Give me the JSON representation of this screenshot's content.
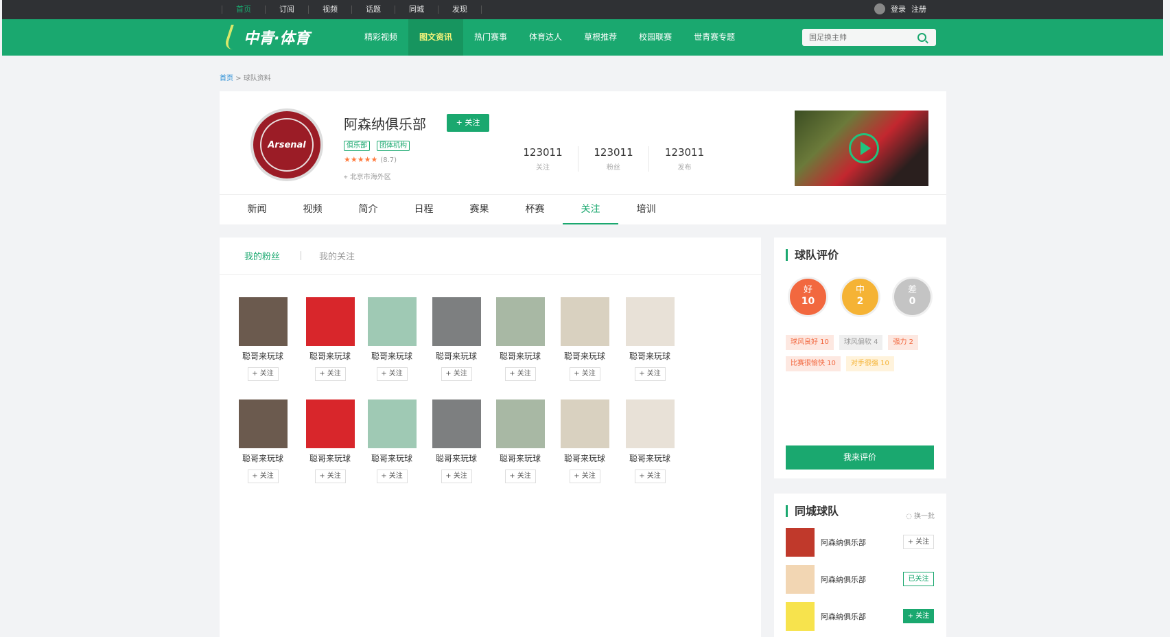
{
  "topbar": {
    "nav": [
      "首页",
      "订阅",
      "视频",
      "话题",
      "同城",
      "发现"
    ],
    "login": "登录",
    "register": "注册"
  },
  "header": {
    "logo_text": "中青·体育",
    "menu": [
      "精彩视频",
      "图文资讯",
      "热门赛事",
      "体育达人",
      "草根推荐",
      "校园联赛",
      "世青赛专题"
    ],
    "search_placeholder": "国足换主帅"
  },
  "breadcrumb": {
    "home": "首页",
    "sep": ">",
    "current": "球队资料"
  },
  "profile": {
    "badge_text": "Arsenal",
    "name": "阿森纳俱乐部",
    "follow_label": "+ 关注",
    "tags": [
      "俱乐部",
      "团体机构"
    ],
    "stars": "★★★★★",
    "score": "(8.7)",
    "location": "北京市海外区",
    "stats": [
      {
        "num": "123011",
        "label": "关注"
      },
      {
        "num": "123011",
        "label": "粉丝"
      },
      {
        "num": "123011",
        "label": "发布"
      }
    ]
  },
  "tabs": [
    "新闻",
    "视频",
    "简介",
    "日程",
    "赛果",
    "杯赛",
    "关注",
    "培训"
  ],
  "subtabs": {
    "fans": "我的粉丝",
    "following": "我的关注"
  },
  "fans": {
    "name": "聪哥来玩球",
    "follow": "+ 关注",
    "avatar_colors": [
      "#6b5a4e",
      "#d8262b",
      "#9fc9b4",
      "#7d7f80",
      "#a8b8a4",
      "#d9d1c0",
      "#e8e1d7"
    ]
  },
  "rating": {
    "title": "球队评价",
    "circles": [
      {
        "label": "好",
        "value": "10",
        "color": "#f2683f"
      },
      {
        "label": "中",
        "value": "2",
        "color": "#f5b335"
      },
      {
        "label": "差",
        "value": "0",
        "color": "#c4c4c4"
      }
    ],
    "chips": [
      {
        "text": "球风良好  10",
        "fg": "#f2683f",
        "bg": "#fde8e1"
      },
      {
        "text": "球风偏软  4",
        "fg": "#999999",
        "bg": "#efefef"
      },
      {
        "text": "强力  2",
        "fg": "#f2683f",
        "bg": "#fde8e1"
      },
      {
        "text": "比赛很愉快  10",
        "fg": "#f2683f",
        "bg": "#fde8e1"
      },
      {
        "text": "对手很强  10",
        "fg": "#f5b335",
        "bg": "#fff3dc"
      }
    ],
    "button": "我来评价"
  },
  "city": {
    "title": "同城球队",
    "refresh": "换一批",
    "teams": [
      {
        "name": "阿森纳俱乐部",
        "btn": "+ 关注",
        "state": "plain",
        "color": "#c0392b"
      },
      {
        "name": "阿森纳俱乐部",
        "btn": "已关注",
        "state": "on",
        "color": "#f2d6b3"
      },
      {
        "name": "阿森纳俱乐部",
        "btn": "+ 关注",
        "state": "solid",
        "color": "#f7e34d"
      }
    ]
  }
}
